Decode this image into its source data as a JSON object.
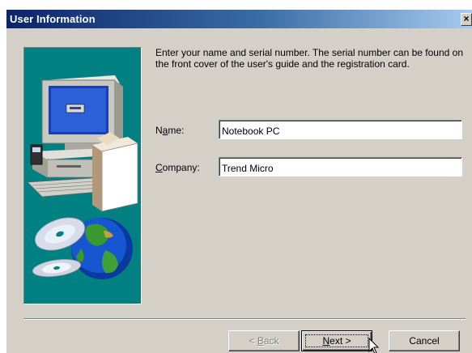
{
  "window": {
    "title": "User Information",
    "close_glyph": "×"
  },
  "content": {
    "instructions": "Enter your name and serial number. The serial number can be found on the front cover of the user's guide and the registration card."
  },
  "fields": {
    "name": {
      "label_prefix": "N",
      "label_accel": "a",
      "label_suffix": "me:",
      "value": "Notebook PC"
    },
    "company": {
      "label_prefix": "",
      "label_accel": "C",
      "label_suffix": "ompany:",
      "value": "Trend Micro"
    }
  },
  "buttons": {
    "back": {
      "prefix": "< ",
      "accel": "B",
      "suffix": "ack",
      "enabled": false
    },
    "next": {
      "prefix": "",
      "accel": "N",
      "suffix": "ext >",
      "enabled": true
    },
    "cancel": {
      "label": "Cancel"
    }
  },
  "colors": {
    "title_gradient_start": "#0a246a",
    "title_gradient_end": "#a6caf0",
    "dialog_face": "#d4d0c8",
    "art_background": "#008080"
  },
  "icons": [
    "computer-illustration",
    "cd-disc-icon",
    "globe-icon",
    "close-icon",
    "mouse-cursor-icon"
  ]
}
